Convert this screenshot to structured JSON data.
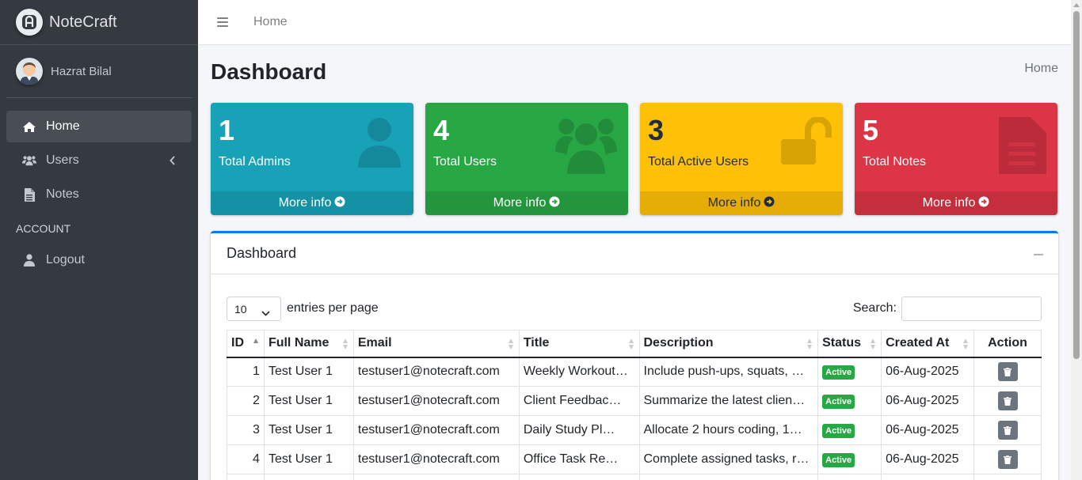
{
  "brand": {
    "name": "NoteCraft",
    "logo_icon": "notecraft-logo-icon"
  },
  "user": {
    "name": "Hazrat Bilal"
  },
  "sidebar": {
    "items": [
      {
        "label": "Home",
        "icon": "home-icon",
        "active": true
      },
      {
        "label": "Users",
        "icon": "users-icon",
        "has_submenu": true
      },
      {
        "label": "Notes",
        "icon": "file-icon"
      }
    ],
    "section_header": "ACCOUNT",
    "account_items": [
      {
        "label": "Logout",
        "icon": "user-icon"
      }
    ]
  },
  "topbar": {
    "home_link": "Home"
  },
  "page": {
    "title": "Dashboard",
    "breadcrumb": "Home"
  },
  "boxes": [
    {
      "value": "1",
      "label": "Total Admins",
      "footer": "More info",
      "color": "#17a2b8",
      "icon": "user-icon"
    },
    {
      "value": "4",
      "label": "Total Users",
      "footer": "More info",
      "color": "#28a745",
      "icon": "users-icon"
    },
    {
      "value": "3",
      "label": "Total Active Users",
      "footer": "More info",
      "color": "#ffc107",
      "icon": "unlock-icon"
    },
    {
      "value": "5",
      "label": "Total Notes",
      "footer": "More info",
      "color": "#dc3545",
      "icon": "file-icon"
    }
  ],
  "card": {
    "title": "Dashboard",
    "length_select": {
      "value": "10",
      "label": "entries per page"
    },
    "search": {
      "label": "Search:",
      "value": ""
    },
    "columns": [
      "ID",
      "Full Name",
      "Email",
      "Title",
      "Description",
      "Status",
      "Created At",
      "Action"
    ],
    "rows": [
      {
        "id": "1",
        "full_name": "Test User 1",
        "email": "testuser1@notecraft.com",
        "title": "Weekly Workout…",
        "description": "Include push-ups, squats, …",
        "status": "Active",
        "created_at": "06-Aug-2025"
      },
      {
        "id": "2",
        "full_name": "Test User 1",
        "email": "testuser1@notecraft.com",
        "title": "Client Feedbac…",
        "description": "Summarize the latest clien…",
        "status": "Active",
        "created_at": "06-Aug-2025"
      },
      {
        "id": "3",
        "full_name": "Test User 1",
        "email": "testuser1@notecraft.com",
        "title": "Daily Study Pl…",
        "description": "Allocate 2 hours coding, 1…",
        "status": "Active",
        "created_at": "06-Aug-2025"
      },
      {
        "id": "4",
        "full_name": "Test User 1",
        "email": "testuser1@notecraft.com",
        "title": "Office Task Re…",
        "description": "Complete assigned tasks, r…",
        "status": "Active",
        "created_at": "06-Aug-2025"
      }
    ]
  }
}
